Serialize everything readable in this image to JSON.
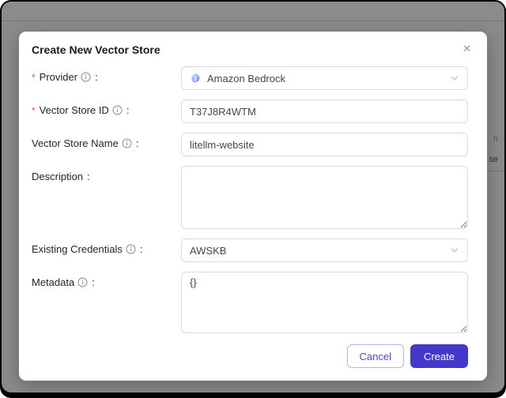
{
  "colors": {
    "overlay": "#8b8b8b",
    "accent": "#4338ca",
    "cancel_accent": "#4f46e5",
    "required_marker_color": "#ff4d4f",
    "input_border": "#d9d9d9"
  },
  "background": {
    "sort_icon": "↑↓",
    "partial_text": "se"
  },
  "modal": {
    "title": "Create New Vector Store",
    "close_icon": "✕",
    "required_marker": "*",
    "colon": ":",
    "fields": [
      {
        "label": "Provider",
        "required": true,
        "type": "select",
        "value": "Amazon Bedrock",
        "icon": "bedrock-logo"
      },
      {
        "label": "Vector Store ID",
        "required": true,
        "type": "input",
        "value": "T37J8R4WTM"
      },
      {
        "label": "Vector Store Name",
        "required": false,
        "type": "input",
        "value": "litellm-website"
      },
      {
        "label": "Description",
        "required": false,
        "type": "textarea",
        "value": ""
      },
      {
        "label": "Existing Credentials",
        "required": false,
        "type": "select",
        "value": "AWSKB"
      },
      {
        "label": "Metadata",
        "required": false,
        "type": "textarea",
        "value": "{}"
      }
    ],
    "footer": {
      "cancel_label": "Cancel",
      "create_label": "Create"
    }
  }
}
